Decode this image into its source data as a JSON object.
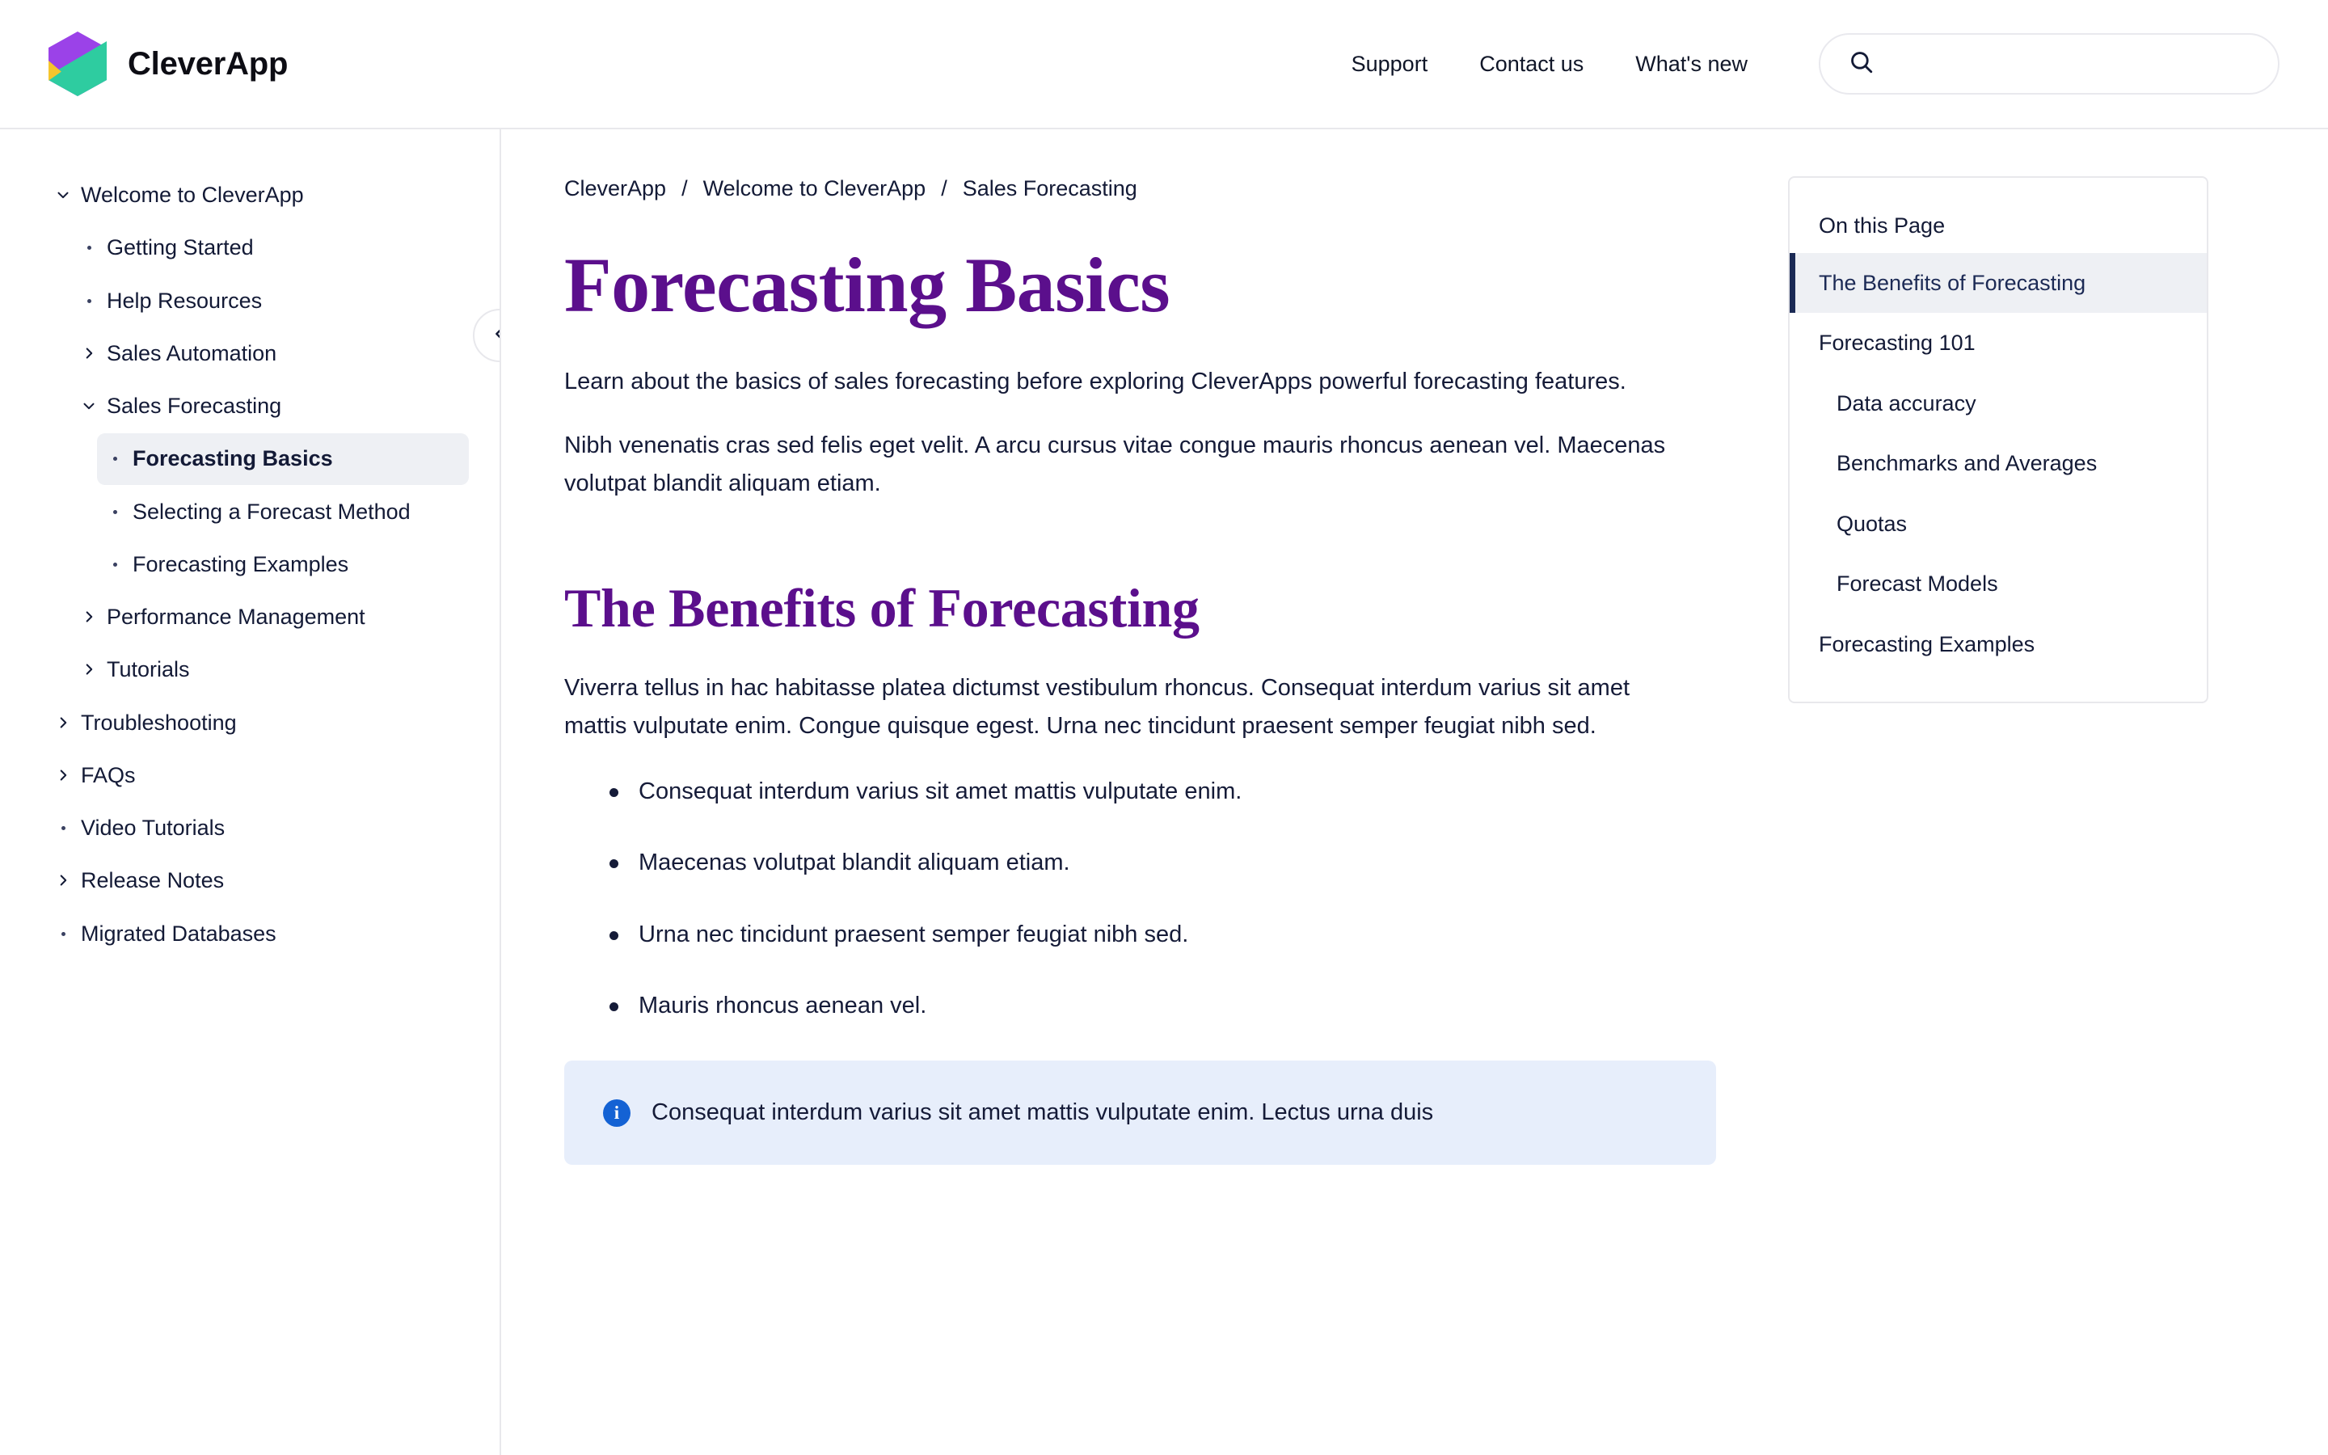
{
  "header": {
    "brand_name": "CleverApp",
    "logo_colors": {
      "purple": "#9B42E8",
      "teal": "#2ECCA0",
      "yellow": "#F6C52C"
    },
    "nav": [
      {
        "label": "Support"
      },
      {
        "label": "Contact us"
      },
      {
        "label": "What's new"
      }
    ],
    "search": {
      "value": "",
      "placeholder": "",
      "icon": "search-icon"
    }
  },
  "sidebar": {
    "collapse_icon": "chevron-left-icon",
    "items": [
      {
        "label": "Welcome to CleverApp",
        "level": 0,
        "marker": "chevron-down",
        "active": false
      },
      {
        "label": "Getting Started",
        "level": 1,
        "marker": "dot",
        "active": false
      },
      {
        "label": "Help Resources",
        "level": 1,
        "marker": "dot",
        "active": false
      },
      {
        "label": "Sales Automation",
        "level": 1,
        "marker": "chevron-right",
        "active": false
      },
      {
        "label": "Sales Forecasting",
        "level": 1,
        "marker": "chevron-down",
        "active": false
      },
      {
        "label": "Forecasting Basics",
        "level": 2,
        "marker": "dot",
        "active": true
      },
      {
        "label": "Selecting a Forecast Method",
        "level": 2,
        "marker": "dot",
        "active": false
      },
      {
        "label": "Forecasting Examples",
        "level": 2,
        "marker": "dot",
        "active": false
      },
      {
        "label": "Performance Management",
        "level": 1,
        "marker": "chevron-right",
        "active": false
      },
      {
        "label": "Tutorials",
        "level": 1,
        "marker": "chevron-right",
        "active": false
      },
      {
        "label": "Troubleshooting",
        "level": 0,
        "marker": "chevron-right",
        "active": false
      },
      {
        "label": "FAQs",
        "level": 0,
        "marker": "chevron-right",
        "active": false
      },
      {
        "label": "Video Tutorials",
        "level": 0,
        "marker": "dot",
        "active": false
      },
      {
        "label": "Release Notes",
        "level": 0,
        "marker": "chevron-right",
        "active": false
      },
      {
        "label": "Migrated Databases",
        "level": 0,
        "marker": "dot",
        "active": false
      }
    ]
  },
  "breadcrumb": {
    "separator": "/",
    "items": [
      {
        "label": "CleverApp"
      },
      {
        "label": "Welcome to CleverApp"
      },
      {
        "label": "Sales Forecasting"
      }
    ]
  },
  "article": {
    "title": "Forecasting Basics",
    "intro_1": "Learn about the basics of sales forecasting before exploring CleverApps powerful forecasting features.",
    "intro_2": "Nibh venenatis cras sed felis eget velit. A arcu cursus vitae congue mauris rhoncus aenean vel. Maecenas volutpat blandit aliquam etiam.",
    "section_title": "The Benefits of Forecasting",
    "section_para": "Viverra tellus in hac habitasse platea dictumst vestibulum rhoncus. Consequat interdum varius sit amet mattis vulputate enim. Congue quisque egest. Urna nec tincidunt praesent semper feugiat nibh sed.",
    "bullets": [
      "Consequat interdum varius sit amet mattis vulputate enim.",
      "Maecenas volutpat blandit aliquam etiam.",
      "Urna nec tincidunt praesent semper feugiat nibh sed.",
      "Mauris rhoncus aenean vel."
    ],
    "callout": {
      "icon": "info-icon",
      "text": "Consequat interdum varius sit amet mattis vulputate enim. Lectus urna duis",
      "background": "#E7EEFB",
      "icon_color": "#1462D4"
    },
    "heading_color": "#5B0F8C"
  },
  "toc": {
    "title": "On this Page",
    "items": [
      {
        "label": "The Benefits of Forecasting",
        "sub": false,
        "active": true
      },
      {
        "label": "Forecasting 101",
        "sub": false,
        "active": false
      },
      {
        "label": "Data accuracy",
        "sub": true,
        "active": false
      },
      {
        "label": "Benchmarks and Averages",
        "sub": true,
        "active": false
      },
      {
        "label": "Quotas",
        "sub": true,
        "active": false
      },
      {
        "label": "Forecast Models",
        "sub": true,
        "active": false
      },
      {
        "label": "Forecasting Examples",
        "sub": false,
        "active": false
      }
    ]
  }
}
